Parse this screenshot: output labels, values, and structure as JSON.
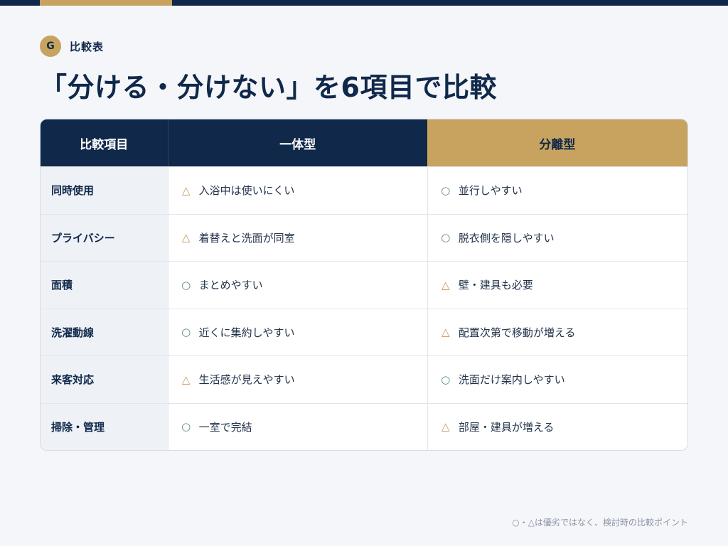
{
  "header": {
    "badge": "G",
    "eyebrow": "比較表",
    "title": "「分ける・分けない」を6項目で比較"
  },
  "table": {
    "columns": [
      "比較項目",
      "一体型",
      "分離型"
    ],
    "rows": [
      {
        "item": "同時使用",
        "integrated": {
          "mark": "△",
          "text": "入浴中は使いにくい"
        },
        "separated": {
          "mark": "○",
          "text": "並行しやすい"
        }
      },
      {
        "item": "プライバシー",
        "integrated": {
          "mark": "△",
          "text": "着替えと洗面が同室"
        },
        "separated": {
          "mark": "○",
          "text": "脱衣側を隠しやすい"
        }
      },
      {
        "item": "面積",
        "integrated": {
          "mark": "○",
          "text": "まとめやすい"
        },
        "separated": {
          "mark": "△",
          "text": "壁・建具も必要"
        }
      },
      {
        "item": "洗濯動線",
        "integrated": {
          "mark": "○",
          "text": "近くに集約しやすい"
        },
        "separated": {
          "mark": "△",
          "text": "配置次第で移動が増える"
        }
      },
      {
        "item": "来客対応",
        "integrated": {
          "mark": "△",
          "text": "生活感が見えやすい"
        },
        "separated": {
          "mark": "○",
          "text": "洗面だけ案内しやすい"
        }
      },
      {
        "item": "掃除・管理",
        "integrated": {
          "mark": "○",
          "text": "一室で完結"
        },
        "separated": {
          "mark": "△",
          "text": "部屋・建具が増える"
        }
      }
    ]
  },
  "footnote": "○・△は優劣ではなく、検討時の比較ポイント",
  "colors": {
    "navy": "#10284a",
    "gold": "#c7a35f",
    "triangle": "#c4955a",
    "circle": "#5d8a80"
  }
}
